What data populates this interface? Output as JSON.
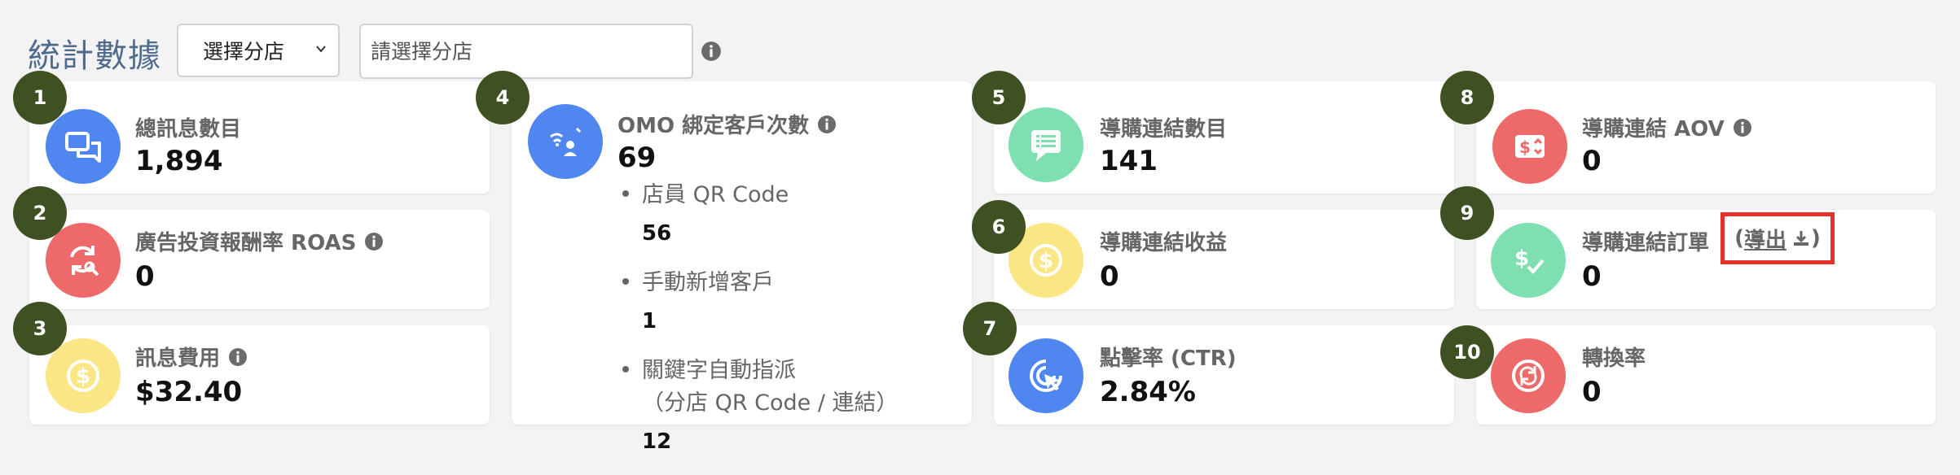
{
  "header": {
    "title": "統計數據",
    "branch_select": "選擇分店",
    "branch_input_placeholder": "請選擇分店"
  },
  "colors": {
    "badge": "#3f5122",
    "blue": "#4f86f0",
    "red": "#ee6a6a",
    "yellow": "#fbe686",
    "green": "#7ee0b0",
    "highlight": "#e4312a"
  },
  "cards": [
    {
      "badge": "1",
      "title": "總訊息數目",
      "value": "1,894",
      "icon": "chat-icon"
    },
    {
      "badge": "2",
      "title": "廣告投資報酬率 ROAS",
      "value": "0",
      "icon": "roas-icon"
    },
    {
      "badge": "3",
      "title": "訊息費用",
      "value": "$32.40",
      "icon": "dollar-icon"
    },
    {
      "badge": "4",
      "title": "OMO 綁定客戶次數",
      "value": "69",
      "icon": "omo-icon",
      "items": [
        {
          "label": "店員 QR Code",
          "value": "56"
        },
        {
          "label": "手動新增客戶",
          "value": "1"
        },
        {
          "label": "關鍵字自動指派",
          "label2": "（分店 QR Code / 連結）",
          "value": "12"
        }
      ]
    },
    {
      "badge": "5",
      "title": "導購連結數目",
      "value": "141",
      "icon": "message-list-icon"
    },
    {
      "badge": "6",
      "title": "導購連結收益",
      "value": "0",
      "icon": "dollar-icon"
    },
    {
      "badge": "7",
      "title": "點擊率 (CTR)",
      "value": "2.84%",
      "icon": "click-icon"
    },
    {
      "badge": "8",
      "title": "導購連結 AOV",
      "value": "0",
      "icon": "aov-icon"
    },
    {
      "badge": "9",
      "title": "導購連結訂單",
      "value": "0",
      "icon": "dollar-check-icon",
      "export_label": "導出"
    },
    {
      "badge": "10",
      "title": "轉換率",
      "value": "0",
      "icon": "conversion-icon"
    }
  ]
}
